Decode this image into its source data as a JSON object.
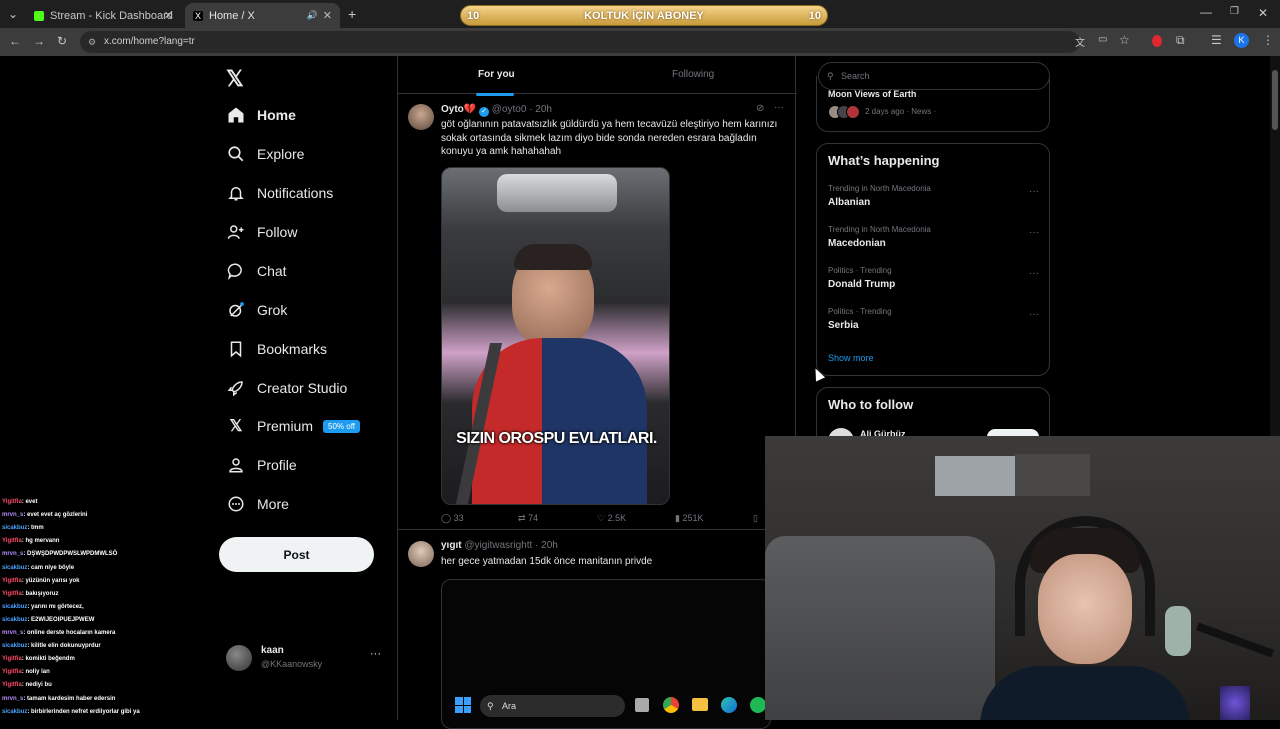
{
  "browser": {
    "tabs": [
      {
        "label": "Stream - Kick Dashboard",
        "active": false
      },
      {
        "label": "Home / X",
        "active": true
      }
    ],
    "url": "x.com/home?lang=tr",
    "banner": {
      "text": "KOLTUK İÇİN ABONEY",
      "left_num": "10",
      "right_num": "10"
    }
  },
  "nav": {
    "items": [
      {
        "label": "Home",
        "icon": "home-icon"
      },
      {
        "label": "Explore",
        "icon": "search-icon"
      },
      {
        "label": "Notifications",
        "icon": "bell-icon"
      },
      {
        "label": "Follow",
        "icon": "person-add-icon"
      },
      {
        "label": "Chat",
        "icon": "chat-icon"
      },
      {
        "label": "Grok",
        "icon": "grok-icon"
      },
      {
        "label": "Bookmarks",
        "icon": "bookmark-icon"
      },
      {
        "label": "Creator Studio",
        "icon": "rocket-icon"
      },
      {
        "label": "Premium",
        "icon": "x-logo-icon",
        "badge": "50% off"
      },
      {
        "label": "Profile",
        "icon": "person-icon"
      },
      {
        "label": "More",
        "icon": "more-circle-icon"
      }
    ],
    "post_label": "Post",
    "account": {
      "name": "kaan",
      "handle": "@KKaanowsky"
    }
  },
  "timeline": {
    "tabs": [
      "For you",
      "Following"
    ],
    "tweets": [
      {
        "name": "Oyto💔",
        "handle": "@oyto0",
        "time": "· 20h",
        "text": "göt oğlanının patavatsızlık güldürdü ya hem tecavüzü eleştiriyo hem karınızı sokak ortasında sikmek lazım diyo bide sonda nereden esrara bağladın konuyu ya amk hahahahah",
        "video_caption": "SIZIN OROSPU EVLATLARI.",
        "stats": {
          "replies": "33",
          "reposts": "74",
          "likes": "2.5K",
          "views": "251K"
        }
      },
      {
        "name": "yıgıt",
        "handle": "@yigitwasrightt",
        "time": "· 20h",
        "text": "her gece yatmadan 15dk önce manitanın privde"
      }
    ]
  },
  "sidebar": {
    "search_placeholder": "Search",
    "news": {
      "title": "Moon Views of Earth",
      "meta": "2 days ago · News ·"
    },
    "happening": {
      "title": "What’s happening",
      "trends": [
        {
          "meta": "Trending in North Macedonia",
          "name": "Albanian"
        },
        {
          "meta": "Trending in North Macedonia",
          "name": "Macedonian"
        },
        {
          "meta": "Politics · Trending",
          "name": "Donald Trump"
        },
        {
          "meta": "Politics · Trending",
          "name": "Serbia"
        }
      ],
      "show_more": "Show more"
    },
    "who_to_follow": {
      "title": "Who to follow",
      "first": "Ali Gürbüz"
    }
  },
  "chat": [
    {
      "user": "Yigitfia",
      "msg": ": evet",
      "color": "red"
    },
    {
      "user": "mrvn_s",
      "msg": ": evet evet aç gözlerini",
      "color": "purple"
    },
    {
      "user": "sicakbuz",
      "msg": ": tmm",
      "color": "blue"
    },
    {
      "user": "Yigitfia",
      "msg": ": hg mervann",
      "color": "red"
    },
    {
      "user": "mrvn_s",
      "msg": ": DŞWŞDPWDPWSLWPDMWLSÖ",
      "color": "purple"
    },
    {
      "user": "sicakbuz",
      "msg": ": cam niye böyle",
      "color": "blue"
    },
    {
      "user": "Yigitfia",
      "msg": ": yüzünün yarısı yok",
      "color": "red"
    },
    {
      "user": "Yigitfia",
      "msg": ": bakışıyoruz",
      "color": "red"
    },
    {
      "user": "sicakbuz",
      "msg": ": yarını mı görtecez,",
      "color": "blue"
    },
    {
      "user": "sicakbuz",
      "msg": ": E2WIJEOIPUEJPWEW",
      "color": "blue"
    },
    {
      "user": "mrvn_s",
      "msg": ": online derste hocaların kamera",
      "color": "purple"
    },
    {
      "user": "sicakbuz",
      "msg": ": kilitle elin dokunuyprdur",
      "color": "blue"
    },
    {
      "user": "Yigitfia",
      "msg": ": komikti beğendm",
      "color": "red"
    },
    {
      "user": "Yigitfia",
      "msg": ": noliy lan",
      "color": "red"
    },
    {
      "user": "Yigitfia",
      "msg": ": nediyi bu",
      "color": "red"
    },
    {
      "user": "mrvn_s",
      "msg": ": tamam kardesim haber edersin",
      "color": "purple"
    },
    {
      "user": "sicakbuz",
      "msg": ": birbirlerinden nefret erdiiyorlar gibi ya",
      "color": "blue"
    }
  ],
  "taskbar": {
    "search_label": "Ara"
  },
  "colors": {
    "accent": "#1d9bf0",
    "background": "#000000",
    "border": "#2f3336",
    "muted": "#71767b"
  }
}
